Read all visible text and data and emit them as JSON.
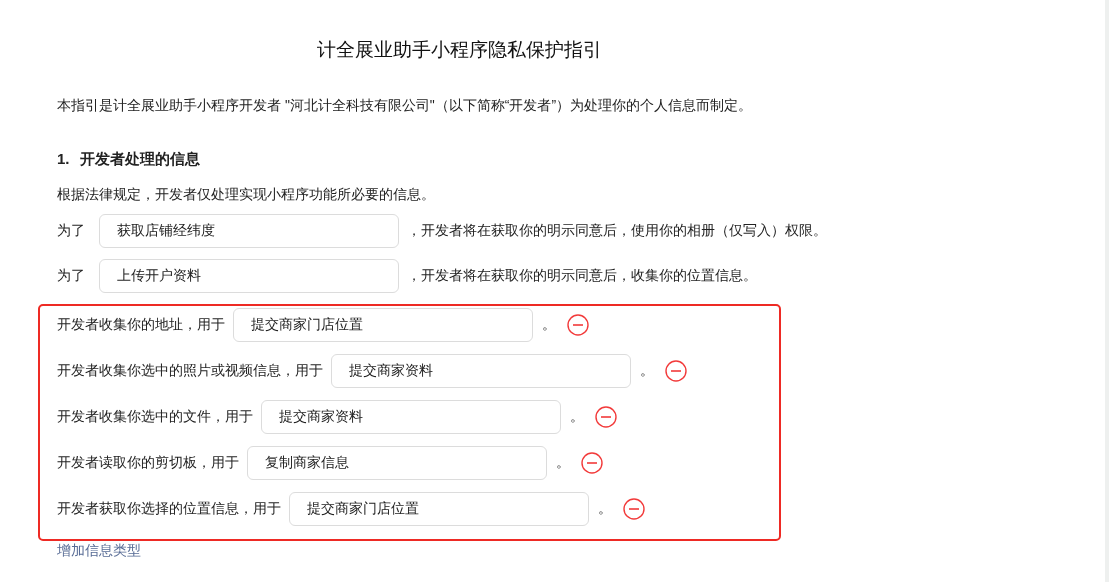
{
  "title": "计全展业助手小程序隐私保护指引",
  "intro": "本指引是计全展业助手小程序开发者 \"河北计全科技有限公司\"（以下简称“开发者”）为处理你的个人信息而制定。",
  "section": {
    "number": "1.",
    "heading": "开发者处理的信息"
  },
  "note": "根据法律规定，开发者仅处理实现小程序功能所必要的信息。",
  "permission_rows": [
    {
      "prefix": "为了",
      "value": "获取店铺经纬度",
      "suffix": "，开发者将在获取你的明示同意后，使用你的相册（仅写入）权限。"
    },
    {
      "prefix": "为了",
      "value": "上传开户资料",
      "suffix": "，开发者将在获取你的明示同意后，收集你的位置信息。"
    }
  ],
  "collection_rows": [
    {
      "label": "开发者收集你的地址，用于",
      "value": "提交商家门店位置",
      "end": "。"
    },
    {
      "label": "开发者收集你选中的照片或视频信息，用于",
      "value": "提交商家资料",
      "end": "。"
    },
    {
      "label": "开发者收集你选中的文件，用于",
      "value": "提交商家资料",
      "end": "。"
    },
    {
      "label": "开发者读取你的剪切板，用于",
      "value": "复制商家信息",
      "end": "。"
    },
    {
      "label": "开发者获取你选择的位置信息，用于",
      "value": "提交商家门店位置",
      "end": "。"
    }
  ],
  "add_link": "增加信息类型"
}
